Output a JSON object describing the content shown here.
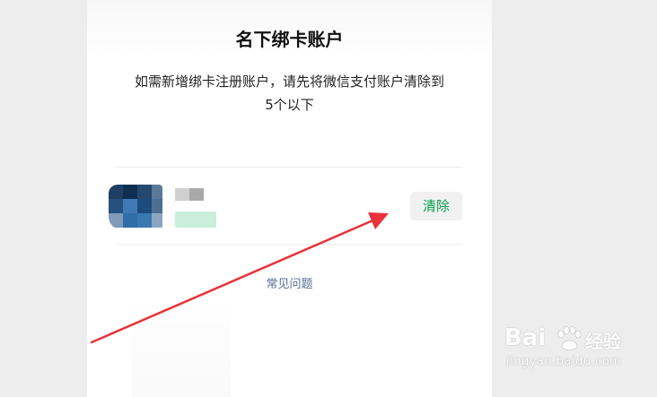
{
  "dialog": {
    "title": "名下绑卡账户",
    "description_line1": "如需新增绑卡注册账户，请先将微信支付账户清除到",
    "description_line2": "5个以下"
  },
  "accounts": [
    {
      "avatar_icon": "blurred-avatar",
      "name": "",
      "detail": "",
      "action_label": "清除"
    }
  ],
  "footer": {
    "faq_link": "常见问题"
  },
  "annotation": {
    "arrow_color": "#e8333a"
  },
  "watermark": {
    "brand": "Bai",
    "brand_icon": "paw-icon",
    "product": "经验",
    "url": "jingyan.baidu.com"
  },
  "colors": {
    "accent_green": "#07a14a",
    "link_blue": "#576b95",
    "background": "#ededed",
    "panel": "#ffffff"
  }
}
